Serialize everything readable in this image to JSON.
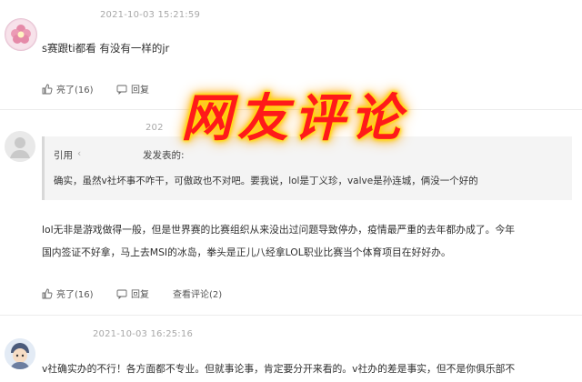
{
  "comments": [
    {
      "timestamp": "2021-10-03 15:21:59",
      "text": "s赛跟ti都看 有没有一样的jr",
      "like_label": "亮了(16)",
      "reply_label": "回复"
    },
    {
      "timestamp_partial": "202",
      "quote_prefix": "引用",
      "quote_suffix": "发发表的:",
      "quote_text": "确实，虽然v社坏事不咋干，可傲政也不对吧。要我说，lol是丁义珍，valve是孙连城，俩没一个好的",
      "body_line1": "lol无非是游戏做得一般，但是世界赛的比赛组织从来没出过问题导致停办，疫情最严重的去年都办成了。今年",
      "body_line2": "国内签证不好拿，马上去MSI的冰岛，拳头是正儿八经拿LOL职业比赛当个体育项目在好好办。",
      "like_label": "亮了(16)",
      "reply_label": "回复",
      "view_reply_label": "查看评论(2)"
    },
    {
      "timestamp": "2021-10-03 16:25:16",
      "text": "v社确实办的不行！各方面都不专业。但就事论事，肯定要分开来看的。v社办的差是事实，但不是你俱乐部不"
    }
  ],
  "overlay_banner": "网友评论",
  "colors": {
    "banner_text": "#ff1a1a",
    "banner_glow": "#ffd000"
  },
  "icons": [
    "avatar-icon",
    "like-icon",
    "reply-icon"
  ]
}
